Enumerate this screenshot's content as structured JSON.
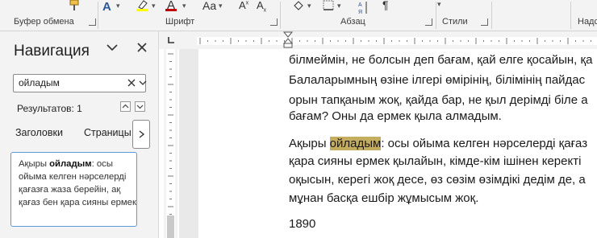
{
  "ribbon": {
    "groups": [
      {
        "label": "Буфер обмена"
      },
      {
        "label": "Шрифт"
      },
      {
        "label": "Абзац"
      },
      {
        "label": "Стили"
      },
      {
        "label": "Надс"
      }
    ],
    "font_size_label": "Aa"
  },
  "navigation": {
    "title": "Навигация",
    "search_value": "ойладым",
    "results_text": "Результатов: 1",
    "tabs": [
      {
        "label": "Заголовки"
      },
      {
        "label": "Страницы"
      }
    ],
    "result_snippet": {
      "before": "Ақыры ",
      "match": "ойладым",
      "after": ": осы ойыма келген нәрселерді қағазға жаза берейін, ақ қағаз бен қара сияны ермек"
    }
  },
  "document": {
    "lines": [
      "білмеймін, не болсын деп бағам, қай елге қосайын, қа",
      "Балаларымның өзіне ілгері өмірінің, білімінің пайдас",
      "орын тапқаным жоқ, қайда бар, не қыл дерімді біле а",
      "бағам? Оны да ермек қыла алмадым."
    ],
    "para2": {
      "before": "Ақыры ",
      "match": "ойладым",
      "after": ": осы ойыма келген нәрселерді қағаз"
    },
    "para2_lines": [
      "қара сияны ермек қылайын, кімде-кім ішінен керекті",
      "оқысын, керегі жоқ десе, өз сөзім өзімдікі дедім де, а",
      "мұнан басқа ешбір жұмысым жоқ."
    ],
    "year": "1890"
  },
  "colors": {
    "highlight": "#c5ad5f",
    "selection_border": "#5b9bd5",
    "font_color_red": "#c00000",
    "highlight_yellow": "#ffff00",
    "accent_blue": "#2b579a"
  }
}
